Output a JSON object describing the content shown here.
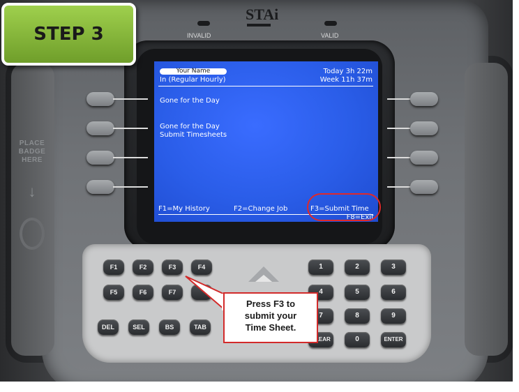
{
  "step_badge": {
    "label": "STEP 3",
    "color": "#8bbf3d"
  },
  "device": {
    "brand": "STAi",
    "leds": {
      "invalid": "INVALID",
      "valid": "VALID"
    },
    "badge_area": {
      "label": "PLACE BADGE HERE"
    }
  },
  "screen": {
    "user_name": "Your Name",
    "status": "In (Regular Hourly)",
    "today": "Today  3h 22m",
    "week": "Week  11h 37m",
    "lines": [
      "Gone for the Day",
      "Gone for the Day",
      "Submit Timesheets"
    ],
    "softkeys": {
      "f1": "F1=My History",
      "f2": "F2=Change Job",
      "f3": "F3=Submit Time",
      "f8": "F8=Exit"
    },
    "highlight_color": "#e0292a"
  },
  "keypad": {
    "function_row1": [
      "F1",
      "F2",
      "F3",
      "F4"
    ],
    "function_row2": [
      "F5",
      "F6",
      "F7"
    ],
    "edit_row": [
      "DEL",
      "SEL",
      "BS",
      "TAB"
    ],
    "numbers_row1": [
      "1",
      "2",
      "3"
    ],
    "numbers_row2": [
      "4",
      "5",
      "6"
    ],
    "numbers_row3": [
      "7",
      "8",
      "9"
    ],
    "bottom_row": [
      "CLEAR",
      "0",
      "ENTER"
    ]
  },
  "callout": {
    "text_line1": "Press F3 to",
    "text_line2": "submit your",
    "text_line3": "Time Sheet.",
    "border_color": "#d22a2a"
  }
}
